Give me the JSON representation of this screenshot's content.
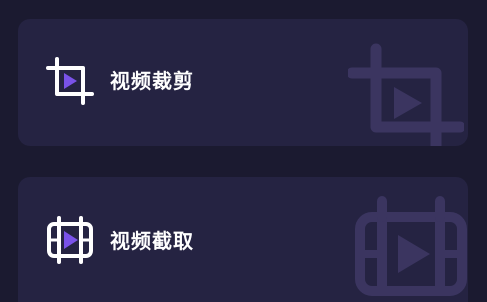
{
  "colors": {
    "background": "#1b1a30",
    "card": "#252342",
    "accent": "#7a52e8",
    "icon_stroke": "#ffffff",
    "watermark": "#3b3560"
  },
  "features": [
    {
      "label": "视频裁剪",
      "icon": "crop-icon"
    },
    {
      "label": "视频截取",
      "icon": "video-clip-icon"
    }
  ]
}
